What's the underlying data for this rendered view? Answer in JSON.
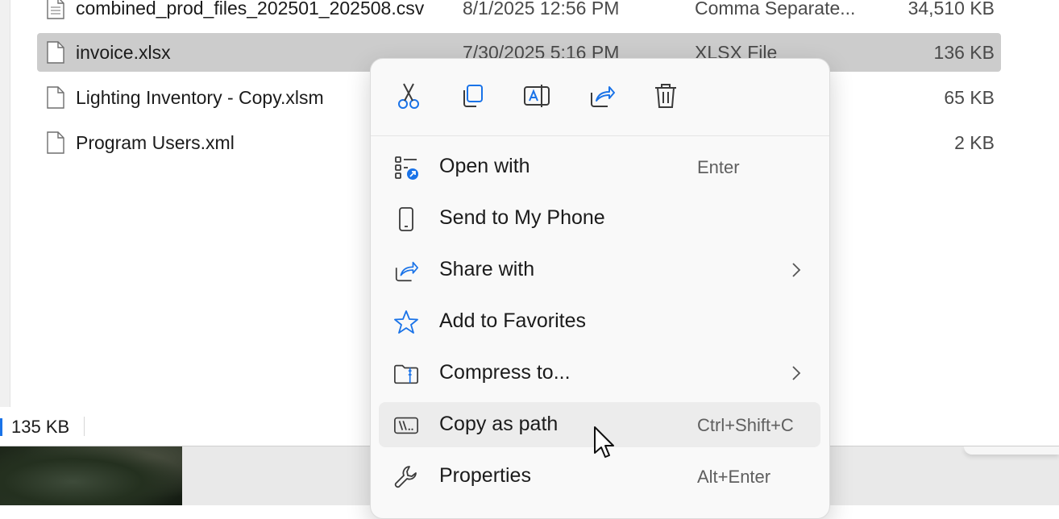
{
  "files": [
    {
      "name": "combined_prod_files_202501_202508.csv",
      "date": "8/1/2025 12:56 PM",
      "type": "Comma Separate...",
      "size": "34,510 KB",
      "selected": false
    },
    {
      "name": "invoice.xlsx",
      "date": "7/30/2025 5:16 PM",
      "type": "XLSX File",
      "size": "136 KB",
      "selected": true
    },
    {
      "name": "Lighting Inventory - Copy.xlsm",
      "date": "",
      "type": "",
      "size": "65 KB",
      "selected": false
    },
    {
      "name": "Program Users.xml",
      "date": "",
      "type": "",
      "size": "2 KB",
      "selected": false
    }
  ],
  "status_bar": {
    "selection_size": "135 KB"
  },
  "context_menu": {
    "quick_actions": [
      {
        "icon": "cut-icon"
      },
      {
        "icon": "copy-icon"
      },
      {
        "icon": "rename-icon"
      },
      {
        "icon": "share-icon"
      },
      {
        "icon": "delete-icon"
      }
    ],
    "items": [
      {
        "label": "Open with",
        "shortcut": "Enter",
        "icon": "open-with-icon",
        "submenu": false
      },
      {
        "label": "Send to My Phone",
        "shortcut": "",
        "icon": "phone-icon",
        "submenu": false
      },
      {
        "label": "Share with",
        "shortcut": "",
        "icon": "share-icon",
        "submenu": true
      },
      {
        "label": "Add to Favorites",
        "shortcut": "",
        "icon": "star-icon",
        "submenu": false
      },
      {
        "label": "Compress to...",
        "shortcut": "",
        "icon": "compress-folder-icon",
        "submenu": true
      },
      {
        "label": "Copy as path",
        "shortcut": "Ctrl+Shift+C",
        "icon": "copy-path-icon",
        "submenu": false,
        "hovered": true
      },
      {
        "label": "Properties",
        "shortcut": "Alt+Enter",
        "icon": "wrench-icon",
        "submenu": false
      }
    ]
  },
  "colors": {
    "accent": "#1a73e8",
    "selection": "#cccccc",
    "menu_background": "#f9f9f9",
    "hover": "#ececec"
  }
}
